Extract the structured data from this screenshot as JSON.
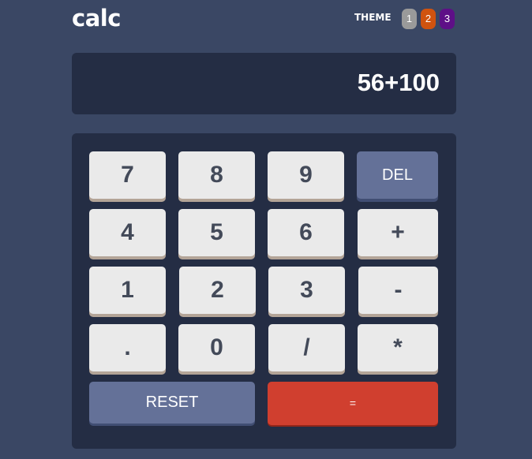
{
  "app": {
    "logo": "calc",
    "theme_label": "THEME",
    "themes": [
      "1",
      "2",
      "3"
    ]
  },
  "screen": {
    "value": "56+100"
  },
  "keys": {
    "row1": [
      "7",
      "8",
      "9",
      "DEL"
    ],
    "row2": [
      "4",
      "5",
      "6",
      "+"
    ],
    "row3": [
      "1",
      "2",
      "3",
      "-"
    ],
    "row4": [
      ".",
      "0",
      "/",
      "*"
    ],
    "reset": "RESET",
    "equals": "="
  },
  "colors": {
    "background": "#3a4764",
    "panel": "#242d44",
    "key": "#eaeaea",
    "key_text": "#434a59",
    "key_dark": "#647198",
    "key_red": "#d03f2f",
    "theme1": "#9a9a9a",
    "theme2": "#d0530f",
    "theme3": "#5e0f87"
  }
}
